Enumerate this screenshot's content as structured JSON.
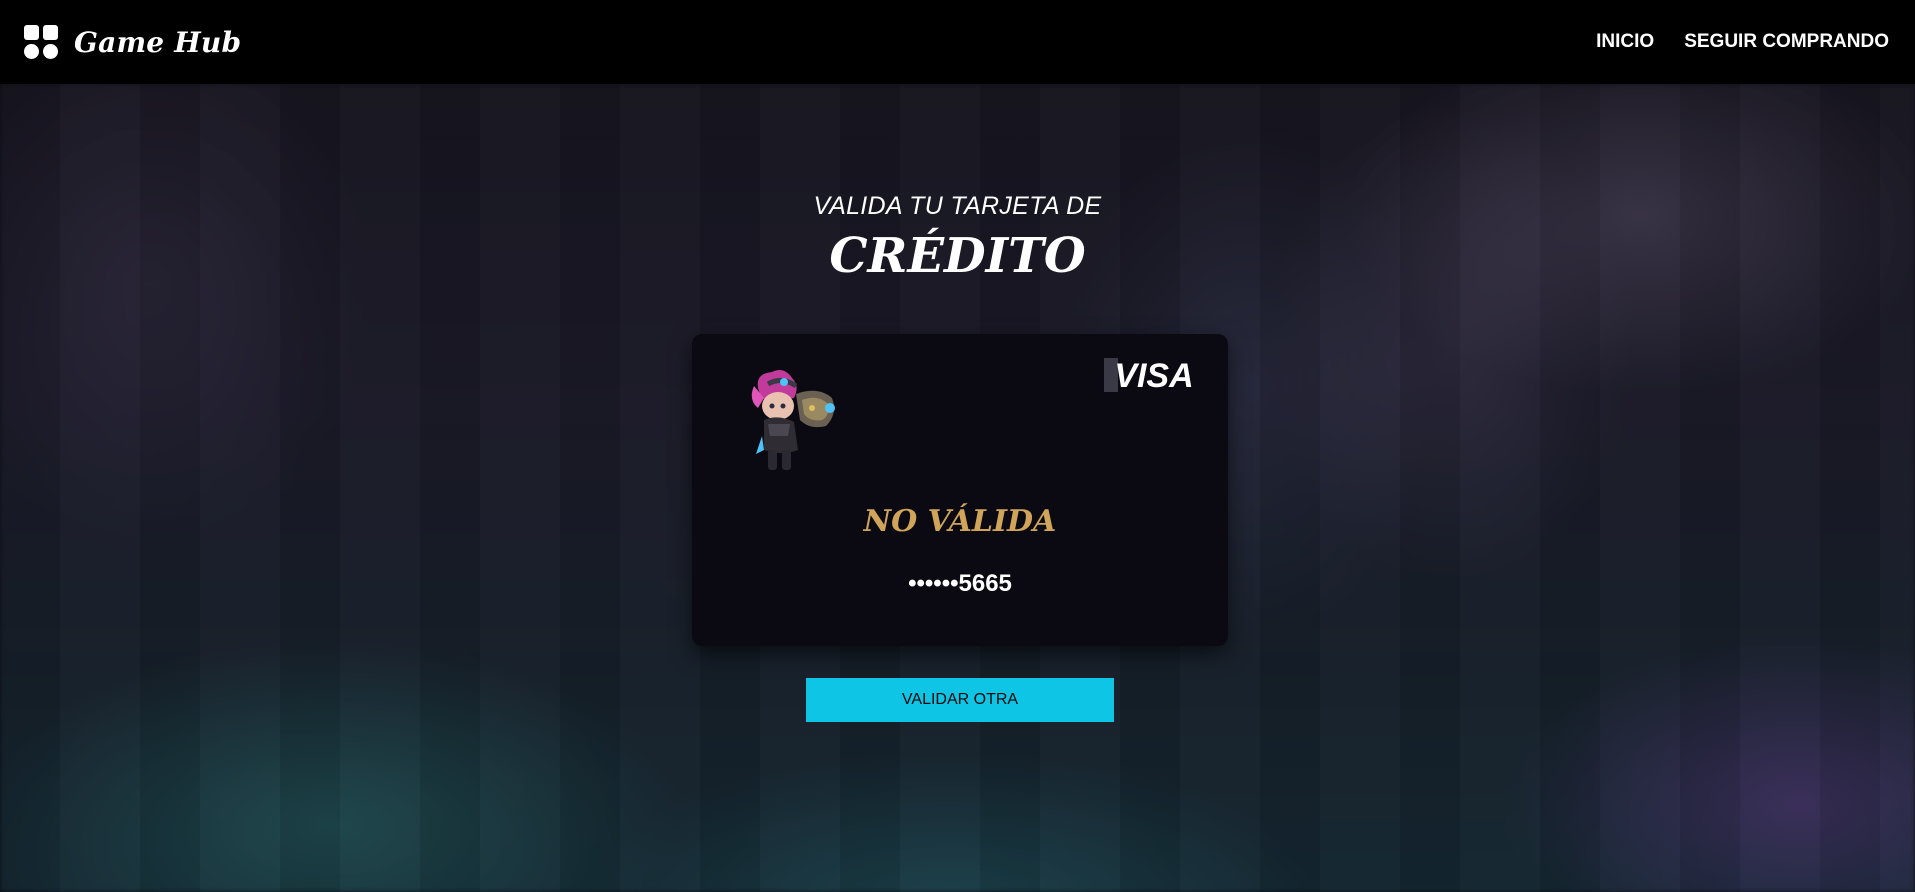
{
  "header": {
    "brand_icon": "grid-apps-icon",
    "brand_name": "Game Hub",
    "nav": [
      {
        "label": "INICIO"
      },
      {
        "label": "SEGUIR COMPRANDO"
      }
    ]
  },
  "main": {
    "subtitle": "VALIDA TU TARJETA DE",
    "title": "CRÉDITO"
  },
  "card": {
    "avatar_icon": "champion-avatar-icon",
    "brand_logo": "VISA",
    "status": "NO VÁLIDA",
    "number": "••••••5665"
  },
  "actions": {
    "validate_other": "VALIDAR OTRA"
  },
  "colors": {
    "accent_button": "#0ec5e6",
    "status_invalid": "#d0a55a",
    "navbar_bg": "#000000",
    "card_bg": "#0b0a13"
  }
}
